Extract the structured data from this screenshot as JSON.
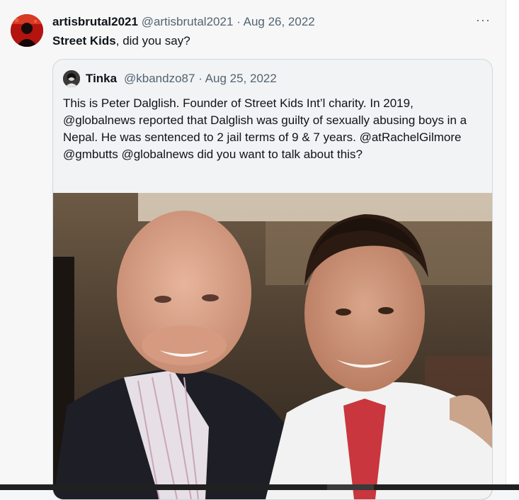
{
  "tweet": {
    "display_name": "artisbrutal2021",
    "handle": "@artisbrutal2021",
    "separator": "·",
    "date": "Aug 26, 2022",
    "more_label": "···",
    "text_bold": "Street Kids",
    "text_rest": ", did you say?"
  },
  "quote": {
    "display_name": "Tinka",
    "handle": "@kbandzo87",
    "separator": "·",
    "date": "Aug 25, 2022",
    "text": "This is Peter Dalglish. Founder of Street Kids Int’l charity. In 2019, @globalnews reported that Dalglish was guilty of sexually abusing boys in a Nepal. He was sentenced to 2 jail terms of 9 & 7 years. @atRachelGilmore @gmbutts @globalnews did you want to talk about this?"
  },
  "colors": {
    "text_primary": "#0f1419",
    "text_secondary": "#536471",
    "border": "#cfd9de",
    "avatar_red": "#c81c16"
  },
  "icons": [
    "more-options-icon"
  ]
}
